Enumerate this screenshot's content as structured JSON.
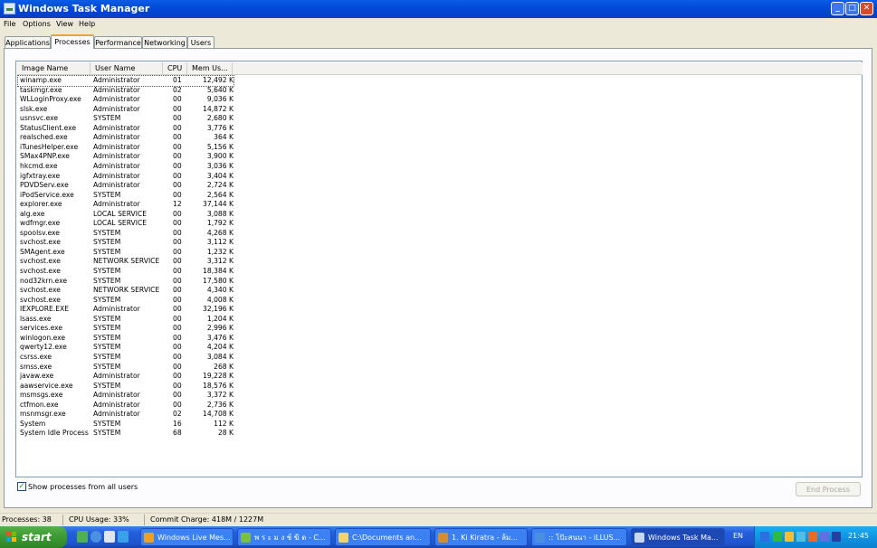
{
  "window": {
    "title": "Windows Task Manager"
  },
  "menu": [
    "File",
    "Options",
    "View",
    "Help"
  ],
  "tabs": [
    "Applications",
    "Processes",
    "Performance",
    "Networking",
    "Users"
  ],
  "columns": [
    "Image Name",
    "User Name",
    "CPU",
    "Mem Us..."
  ],
  "processes": [
    [
      "winamp.exe",
      "Administrator",
      "01",
      "12,492 K"
    ],
    [
      "taskmgr.exe",
      "Administrator",
      "02",
      "5,640 K"
    ],
    [
      "WLLoginProxy.exe",
      "Administrator",
      "00",
      "9,036 K"
    ],
    [
      "slsk.exe",
      "Administrator",
      "00",
      "14,872 K"
    ],
    [
      "usnsvc.exe",
      "SYSTEM",
      "00",
      "2,680 K"
    ],
    [
      "StatusClient.exe",
      "Administrator",
      "00",
      "3,776 K"
    ],
    [
      "realsched.exe",
      "Administrator",
      "00",
      "364 K"
    ],
    [
      "iTunesHelper.exe",
      "Administrator",
      "00",
      "5,156 K"
    ],
    [
      "SMax4PNP.exe",
      "Administrator",
      "00",
      "3,900 K"
    ],
    [
      "hkcmd.exe",
      "Administrator",
      "00",
      "3,036 K"
    ],
    [
      "igfxtray.exe",
      "Administrator",
      "00",
      "3,404 K"
    ],
    [
      "PDVDServ.exe",
      "Administrator",
      "00",
      "2,724 K"
    ],
    [
      "iPodService.exe",
      "SYSTEM",
      "00",
      "2,564 K"
    ],
    [
      "explorer.exe",
      "Administrator",
      "12",
      "37,144 K"
    ],
    [
      "alg.exe",
      "LOCAL SERVICE",
      "00",
      "3,088 K"
    ],
    [
      "wdfmgr.exe",
      "LOCAL SERVICE",
      "00",
      "1,792 K"
    ],
    [
      "spoolsv.exe",
      "SYSTEM",
      "00",
      "4,268 K"
    ],
    [
      "svchost.exe",
      "SYSTEM",
      "00",
      "3,112 K"
    ],
    [
      "SMAgent.exe",
      "SYSTEM",
      "00",
      "1,232 K"
    ],
    [
      "svchost.exe",
      "NETWORK SERVICE",
      "00",
      "3,312 K"
    ],
    [
      "svchost.exe",
      "SYSTEM",
      "00",
      "18,384 K"
    ],
    [
      "nod32krn.exe",
      "SYSTEM",
      "00",
      "17,580 K"
    ],
    [
      "svchost.exe",
      "NETWORK SERVICE",
      "00",
      "4,340 K"
    ],
    [
      "svchost.exe",
      "SYSTEM",
      "00",
      "4,008 K"
    ],
    [
      "IEXPLORE.EXE",
      "Administrator",
      "00",
      "32,196 K"
    ],
    [
      "lsass.exe",
      "SYSTEM",
      "00",
      "1,204 K"
    ],
    [
      "services.exe",
      "SYSTEM",
      "00",
      "2,996 K"
    ],
    [
      "winlogon.exe",
      "SYSTEM",
      "00",
      "3,476 K"
    ],
    [
      "qwerty12.exe",
      "SYSTEM",
      "00",
      "4,204 K"
    ],
    [
      "csrss.exe",
      "SYSTEM",
      "00",
      "3,084 K"
    ],
    [
      "smss.exe",
      "SYSTEM",
      "00",
      "268 K"
    ],
    [
      "javaw.exe",
      "Administrator",
      "00",
      "19,228 K"
    ],
    [
      "aawservice.exe",
      "SYSTEM",
      "00",
      "18,576 K"
    ],
    [
      "msmsgs.exe",
      "Administrator",
      "00",
      "3,372 K"
    ],
    [
      "ctfmon.exe",
      "Administrator",
      "00",
      "2,736 K"
    ],
    [
      "msnmsgr.exe",
      "Administrator",
      "02",
      "14,708 K"
    ],
    [
      "System",
      "SYSTEM",
      "16",
      "112 K"
    ],
    [
      "System Idle Process",
      "SYSTEM",
      "68",
      "28 K"
    ]
  ],
  "options": {
    "show_all_label": "Show processes from all users",
    "show_all_checked": true
  },
  "buttons": {
    "end_process": "End Process"
  },
  "status": {
    "processes": "Processes: 38",
    "cpu": "CPU Usage: 33%",
    "commit": "Commit Charge: 418M / 1227M"
  },
  "taskbar": {
    "start_label": "start",
    "quick_launch_icons": [
      "network-icon",
      "ie-icon",
      "media-icon",
      "messenger-icon"
    ],
    "buttons": [
      {
        "label": "Windows Live Mes...",
        "icon": "messenger-icon",
        "color": "#f0a020"
      },
      {
        "label": "พ ร ะ ม ง ช์ ฆิ ด - C...",
        "icon": "app-icon",
        "color": "#7ac043"
      },
      {
        "label": "C:\\Documents an...",
        "icon": "folder-icon",
        "color": "#f3d36b"
      },
      {
        "label": "1. Ki Kiratra - ล้ม...",
        "icon": "winamp-icon",
        "color": "#d88d2c"
      },
      {
        "label": ":: โปัะสนนา - iLLUS...",
        "icon": "ie-icon",
        "color": "#4a90e2"
      },
      {
        "label": "Windows Task Ma...",
        "icon": "taskmgr-icon",
        "color": "#c8d8f0",
        "active": true
      }
    ],
    "language": "EN",
    "clock": "21:45"
  }
}
